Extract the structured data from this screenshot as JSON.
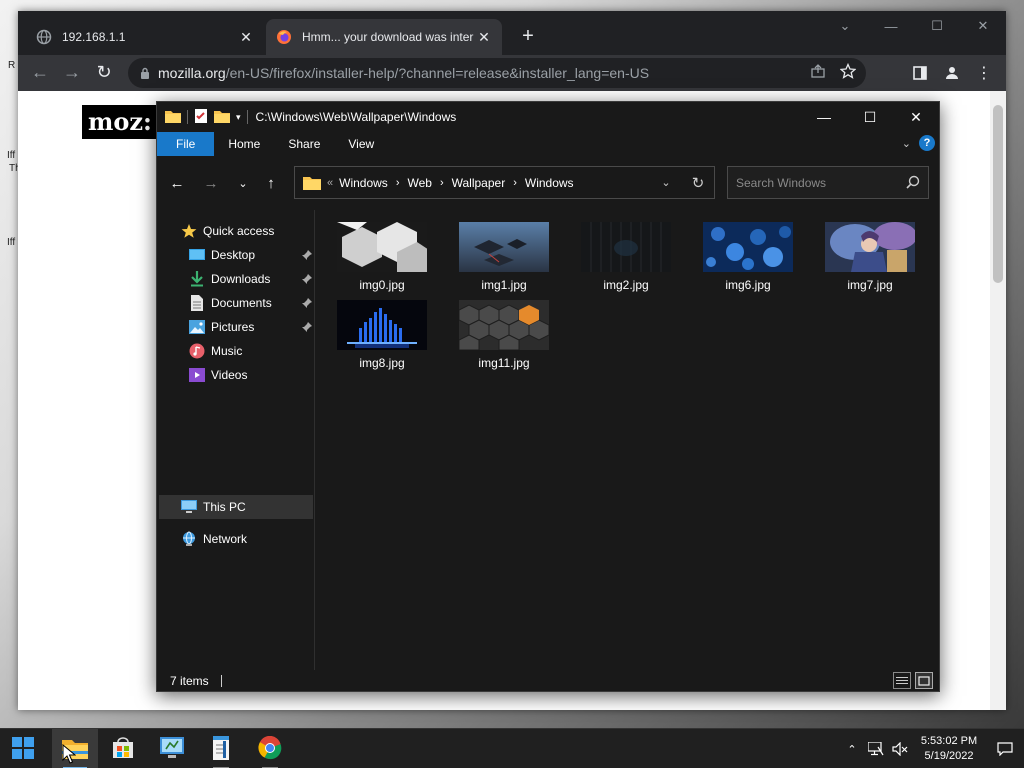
{
  "desktop": {
    "left_fragments": [
      "R",
      "Iff",
      "Th",
      "Iff"
    ]
  },
  "browser": {
    "tabs": [
      {
        "title": "192.168.1.1",
        "active": false
      },
      {
        "title": "Hmm... your download was inter",
        "active": true
      }
    ],
    "url_host": "mozilla.org",
    "url_path": "/en-US/firefox/installer-help/?channel=release&installer_lang=en-US",
    "page_logo_text": "moz:"
  },
  "explorer": {
    "title_path": "C:\\Windows\\Web\\Wallpaper\\Windows",
    "ribbon_tabs": [
      "File",
      "Home",
      "Share",
      "View"
    ],
    "address_overflow": "«",
    "breadcrumbs": [
      "Windows",
      "Web",
      "Wallpaper",
      "Windows"
    ],
    "search_placeholder": "Search Windows",
    "nav": {
      "quick_access": "Quick access",
      "pinned": [
        {
          "label": "Desktop",
          "pinned": true
        },
        {
          "label": "Downloads",
          "pinned": true
        },
        {
          "label": "Documents",
          "pinned": true
        },
        {
          "label": "Pictures",
          "pinned": true
        },
        {
          "label": "Music",
          "pinned": false
        },
        {
          "label": "Videos",
          "pinned": false
        }
      ],
      "this_pc": "This PC",
      "network": "Network"
    },
    "files": [
      "img0.jpg",
      "img1.jpg",
      "img2.jpg",
      "img6.jpg",
      "img7.jpg",
      "img8.jpg",
      "img11.jpg"
    ],
    "status_count": "7 items",
    "view_mode": "large-icons"
  },
  "taskbar": {
    "apps": [
      "start-button",
      "file-explorer",
      "microsoft-store",
      "control-panel",
      "notepad-app",
      "chrome"
    ],
    "active_app": "file-explorer",
    "clock_time": "5:53:02 PM",
    "clock_date": "5/19/2022"
  },
  "colors": {
    "explorer_bg": "#191919",
    "accent": "#1979ca",
    "chrome_frame": "#202124",
    "chrome_toolbar": "#35363a",
    "taskbar_bg": "#202020"
  }
}
